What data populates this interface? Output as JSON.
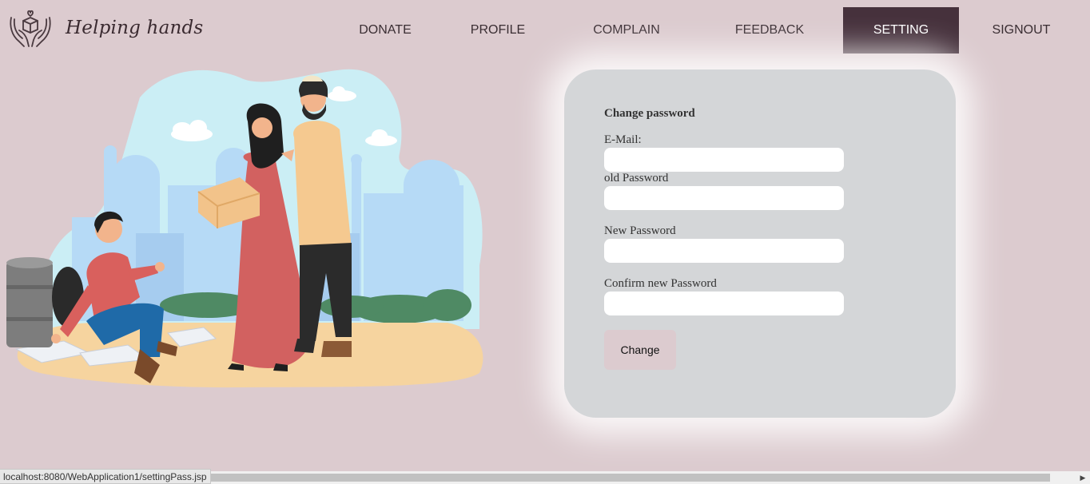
{
  "header": {
    "brand": "Helping hands",
    "logo_icon": "hands-giving-box-icon",
    "nav": [
      {
        "label": "DONATE",
        "active": false
      },
      {
        "label": "PROFILE",
        "active": false
      },
      {
        "label": "COMPLAIN",
        "active": false
      },
      {
        "label": "FEEDBACK",
        "active": false
      },
      {
        "label": "SETTING",
        "active": true
      },
      {
        "label": "SIGNOUT",
        "active": false
      }
    ]
  },
  "illustration": {
    "icon": "donation-scene-illustration"
  },
  "form": {
    "title": "Change password",
    "email_label": "E-Mail:",
    "email_value": "",
    "old_label": "old Password",
    "old_value": "",
    "new_label": "New Password",
    "new_value": "",
    "confirm_label": "Confirm new Password",
    "confirm_value": "",
    "submit_label": "Change"
  },
  "status_bar": {
    "url": "localhost:8080/WebApplication1/settingPass.jsp"
  },
  "colors": {
    "background": "#dccbcf",
    "nav_active": "#46313c",
    "card": "#d4d6d8",
    "button": "#dccbcf"
  }
}
